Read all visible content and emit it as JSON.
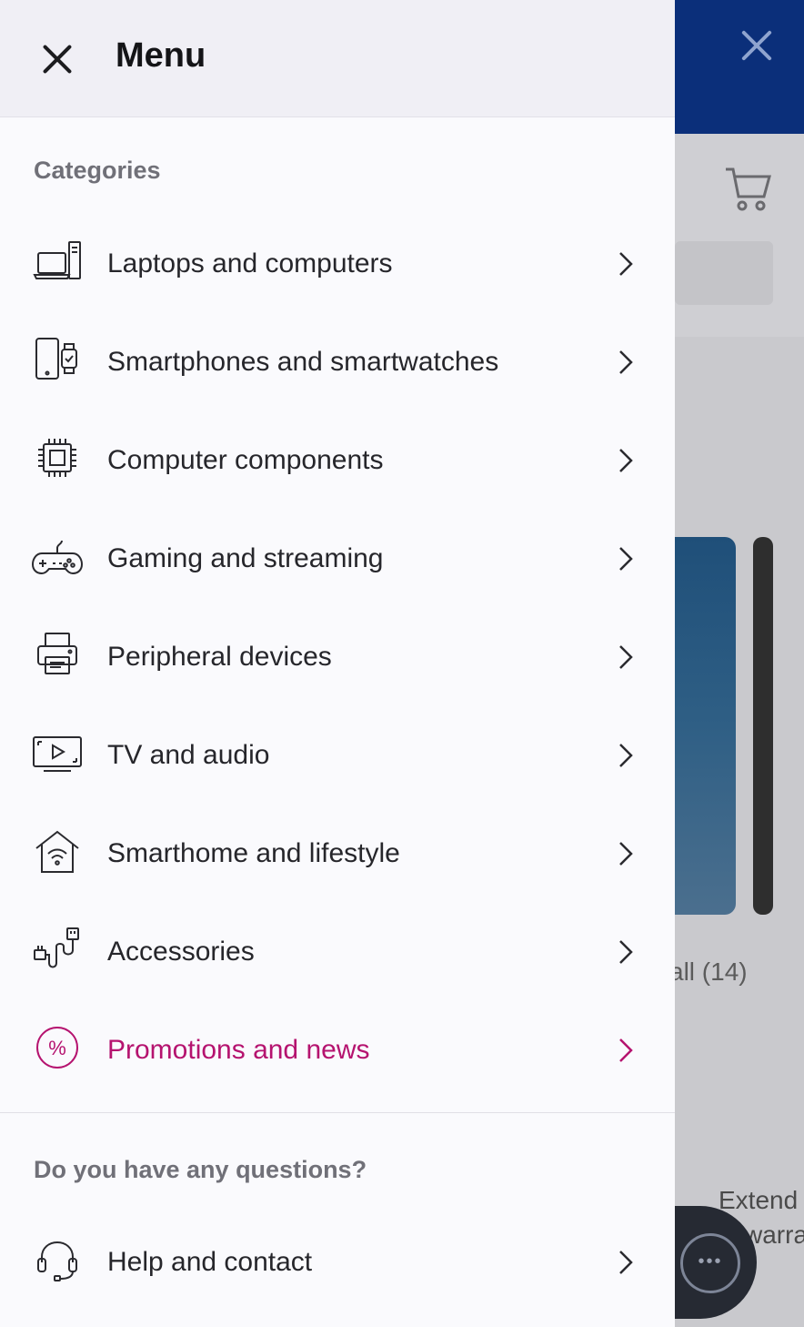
{
  "header": {
    "title": "Menu"
  },
  "categories": {
    "title": "Categories",
    "items": [
      {
        "label": "Laptops and computers",
        "icon": "laptop-computer-icon"
      },
      {
        "label": "Smartphones and smartwatches",
        "icon": "smartphone-watch-icon"
      },
      {
        "label": "Computer components",
        "icon": "cpu-chip-icon"
      },
      {
        "label": "Gaming and streaming",
        "icon": "gamepad-icon"
      },
      {
        "label": "Peripheral devices",
        "icon": "printer-icon"
      },
      {
        "label": "TV and audio",
        "icon": "tv-play-icon"
      },
      {
        "label": "Smarthome and lifestyle",
        "icon": "smart-home-icon"
      },
      {
        "label": "Accessories",
        "icon": "cable-plug-icon"
      },
      {
        "label": "Promotions and news",
        "icon": "percent-icon"
      }
    ]
  },
  "questions": {
    "title": "Do you have any questions?",
    "items": [
      {
        "label": "Help and contact",
        "icon": "headset-icon"
      }
    ]
  },
  "background": {
    "count_text": "all (14)",
    "extend_text_1": "Extend",
    "extend_text_2": "warran"
  },
  "colors": {
    "accent": "#b5136f",
    "header_bg": "#f0eff5",
    "brand_dark": "#0b2f7a"
  }
}
